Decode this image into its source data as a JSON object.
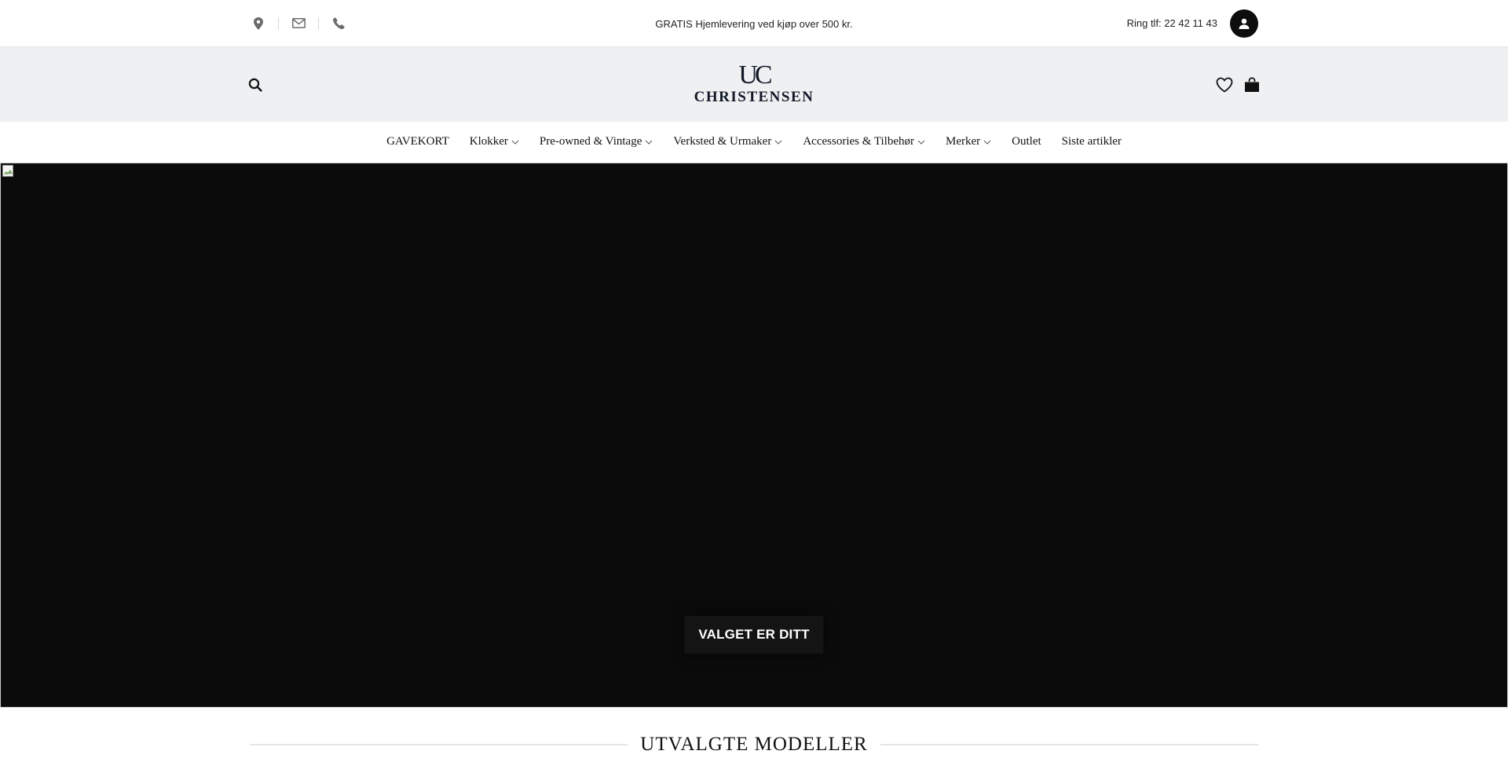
{
  "topbar": {
    "icons": [
      "location-pin-icon",
      "envelope-icon",
      "phone-icon"
    ],
    "promo_text": "GRATIS Hjemlevering ved kjøp over 500 kr.",
    "phone_label": "Ring tlf: 22 42 11 43"
  },
  "header": {
    "logo_mark": "UC",
    "logo_text": "CHRISTENSEN",
    "icons": [
      "search-icon",
      "heart-icon",
      "shopping-bag-icon"
    ]
  },
  "nav": {
    "items": [
      {
        "label": "GAVEKORT",
        "dropdown": false
      },
      {
        "label": "Klokker",
        "dropdown": true
      },
      {
        "label": "Pre-owned & Vintage",
        "dropdown": true
      },
      {
        "label": "Verksted & Urmaker",
        "dropdown": true
      },
      {
        "label": "Accessories & Tilbehør",
        "dropdown": true
      },
      {
        "label": "Merker",
        "dropdown": true
      },
      {
        "label": "Outlet",
        "dropdown": false
      },
      {
        "label": "Siste artikler",
        "dropdown": false
      }
    ]
  },
  "hero": {
    "cta_label": "VALGET ER DITT"
  },
  "section": {
    "title": "UTVALGTE MODELLER"
  },
  "colors": {
    "header_bg": "#eef0f2",
    "hero_bg": "#0b0b0b",
    "account_btn": "#0d0d0d",
    "logo": "#111827"
  }
}
